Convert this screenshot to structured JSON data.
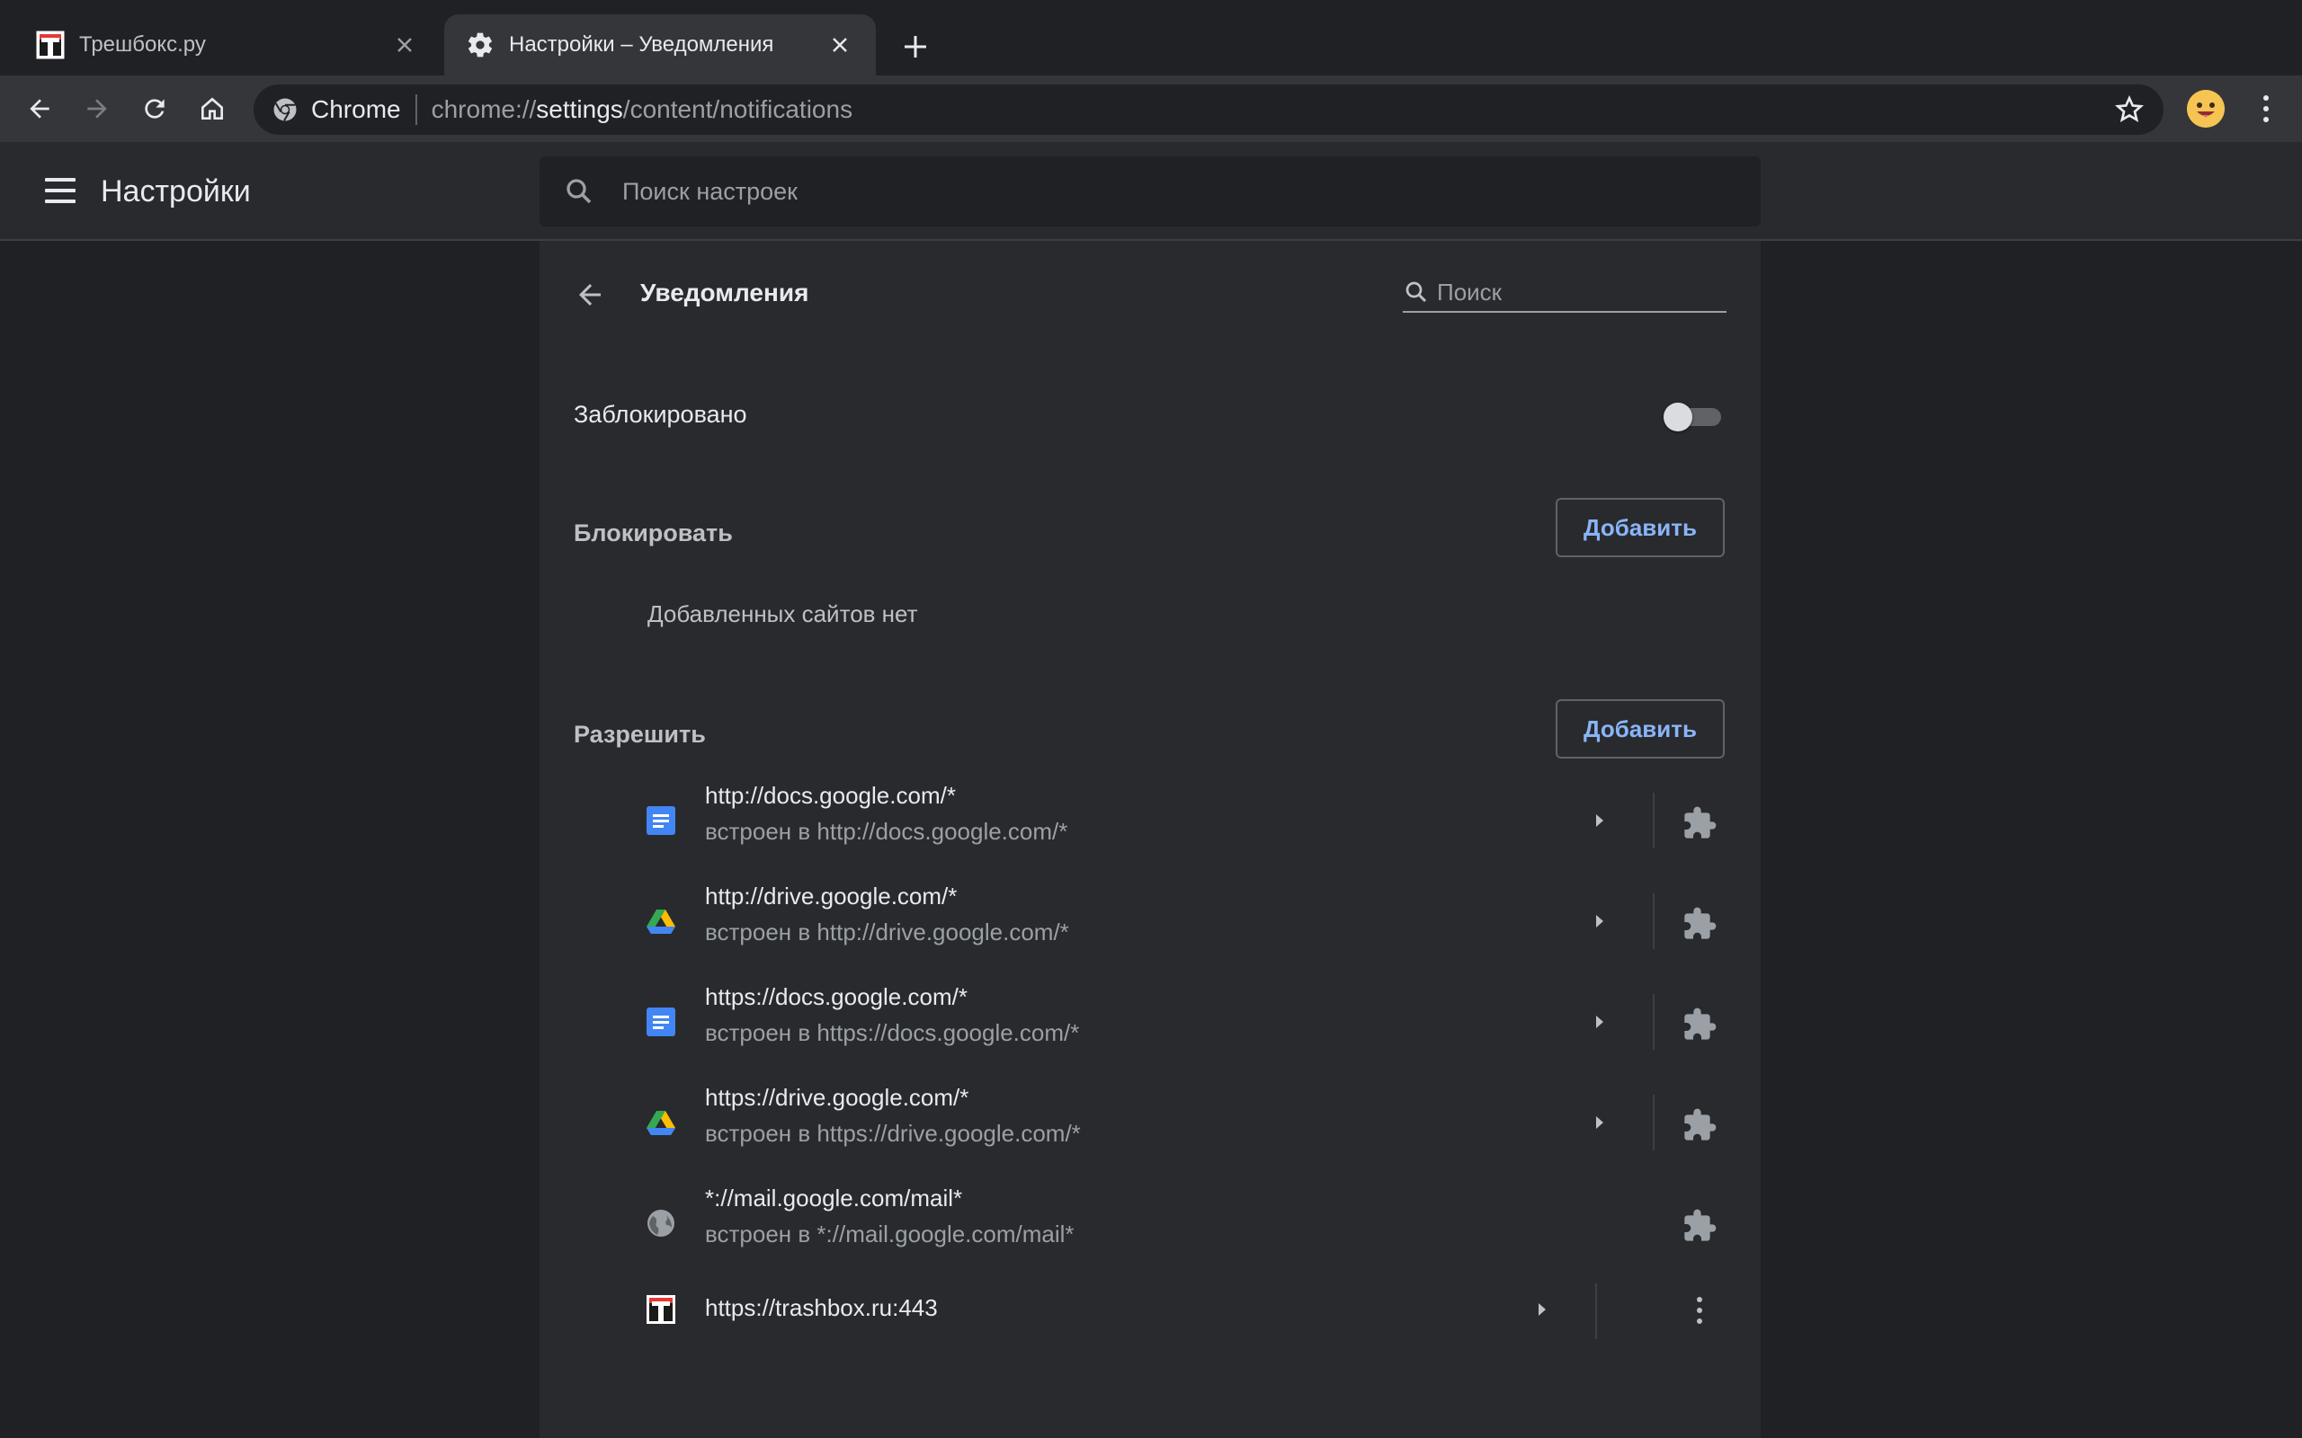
{
  "browser": {
    "tabs": [
      {
        "title": "Трешбокс.ру",
        "favicon": "trashbox-favicon",
        "active": false
      },
      {
        "title": "Настройки – Уведомления",
        "favicon": "gear-icon",
        "active": true
      }
    ],
    "omnibox": {
      "chip": "Chrome",
      "url_prefix": "chrome://",
      "url_bold": "settings",
      "url_suffix": "/content/notifications"
    }
  },
  "settings": {
    "title": "Настройки",
    "search_placeholder": "Поиск настроек"
  },
  "page": {
    "title": "Уведомления",
    "search_placeholder": "Поиск",
    "blocked_label": "Заблокировано",
    "blocked_toggle_on": false,
    "block_section": {
      "label": "Блокировать",
      "add_label": "Добавить",
      "empty_text": "Добавленных сайтов нет"
    },
    "allow_section": {
      "label": "Разрешить",
      "add_label": "Добавить",
      "sites": [
        {
          "url": "http://docs.google.com/*",
          "sub": "встроен в http://docs.google.com/*",
          "icon": "google-docs-icon",
          "has_arrow": true
        },
        {
          "url": "http://drive.google.com/*",
          "sub": "встроен в http://drive.google.com/*",
          "icon": "google-drive-icon",
          "has_arrow": true
        },
        {
          "url": "https://docs.google.com/*",
          "sub": "встроен в https://docs.google.com/*",
          "icon": "google-docs-icon",
          "has_arrow": true
        },
        {
          "url": "https://drive.google.com/*",
          "sub": "встроен в https://drive.google.com/*",
          "icon": "google-drive-icon",
          "has_arrow": true
        },
        {
          "url": "*://mail.google.com/mail*",
          "sub": "встроен в *://mail.google.com/mail*",
          "icon": "globe-icon",
          "has_arrow": false
        },
        {
          "url": "https://trashbox.ru:443",
          "icon": "trashbox-favicon",
          "has_arrow": true
        }
      ]
    }
  },
  "colors": {
    "background": "#202124",
    "card": "#292a2d",
    "accent": "#8ab4f8",
    "text": "#e8eaed",
    "secondary_text": "#9aa0a6"
  }
}
